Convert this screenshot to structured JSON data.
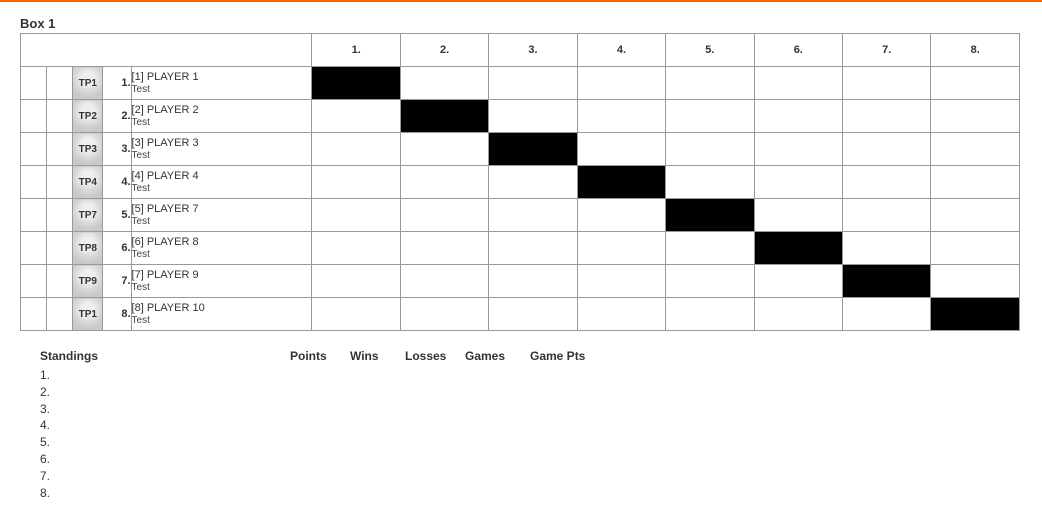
{
  "accentColor": "#ff6600",
  "boxTitle": "Box 1",
  "columnHeaders": [
    "1.",
    "2.",
    "3.",
    "4.",
    "5.",
    "6.",
    "7.",
    "8."
  ],
  "players": [
    {
      "code": "TP1",
      "num": "1.",
      "seed": "[1]",
      "name": "PLAYER 1",
      "club": "Test",
      "selfCol": 0
    },
    {
      "code": "TP2",
      "num": "2.",
      "seed": "[2]",
      "name": "PLAYER 2",
      "club": "Test",
      "selfCol": 1
    },
    {
      "code": "TP3",
      "num": "3.",
      "seed": "[3]",
      "name": "PLAYER 3",
      "club": "Test",
      "selfCol": 2
    },
    {
      "code": "TP4",
      "num": "4.",
      "seed": "[4]",
      "name": "PLAYER 4",
      "club": "Test",
      "selfCol": 3
    },
    {
      "code": "TP7",
      "num": "5.",
      "seed": "[5]",
      "name": "PLAYER 7",
      "club": "Test",
      "selfCol": 4
    },
    {
      "code": "TP8",
      "num": "6.",
      "seed": "[6]",
      "name": "PLAYER 8",
      "club": "Test",
      "selfCol": 5
    },
    {
      "code": "TP9",
      "num": "7.",
      "seed": "[7]",
      "name": "PLAYER 9",
      "club": "Test",
      "selfCol": 6
    },
    {
      "code": "TP1",
      "num": "8.",
      "seed": "[8]",
      "name": "PLAYER 10",
      "club": "Test",
      "selfCol": 7
    }
  ],
  "standings": {
    "title": "Standings",
    "rows": [
      "1.",
      "2.",
      "3.",
      "4.",
      "5.",
      "6.",
      "7.",
      "8."
    ]
  },
  "statsHeaders": {
    "points": "Points",
    "wins": "Wins",
    "losses": "Losses",
    "games": "Games",
    "gamePts": "Game Pts"
  }
}
